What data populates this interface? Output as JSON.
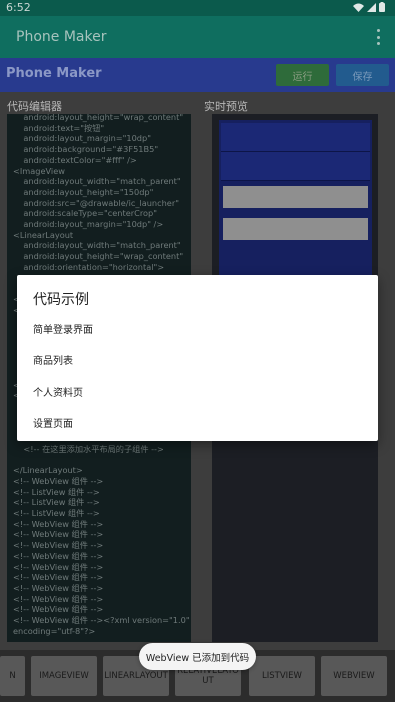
{
  "status": {
    "time": "6:52"
  },
  "appbar": {
    "title": "Phone Maker"
  },
  "toolbar": {
    "title": "Phone Maker",
    "run_label": "运行",
    "save_label": "保存"
  },
  "code_editor": {
    "label": "代码编辑器",
    "text": "    android:layout_height=\"wrap_content\"\n    android:text=\"按钮\"\n    android:layout_margin=\"10dp\"\n    android:background=\"#3F51B5\"\n    android:textColor=\"#fff\" />\n<ImageView\n    android:layout_width=\"match_parent\"\n    android:layout_height=\"150dp\"\n    android:src=\"@drawable/ic_launcher\"\n    android:scaleType=\"centerCrop\"\n    android:layout_margin=\"10dp\" />\n<LinearLayout\n    android:layout_width=\"match_parent\"\n    android:layout_height=\"wrap_content\"\n    android:orientation=\"horizontal\">\n\n\n<\n<\n\n\n\n\n\n\n<\n<\n\n\n\n\n    <!-- 在这里添加水平布局的子组件 -->\n\n</LinearLayout>\n<!-- WebView 组件 -->\n<!-- ListView 组件 -->\n<!-- ListView 组件 -->\n<!-- ListView 组件 -->\n<!-- WebView 组件 -->\n<!-- WebView 组件 -->\n<!-- WebView 组件 -->\n<!-- WebView 组件 -->\n<!-- WebView 组件 -->\n<!-- WebView 组件 -->\n<!-- WebView 组件 -->\n<!-- WebView 组件 -->\n<!-- WebView 组件 -->\n<!-- WebView 组件 --><?xml version=\"1.0\"\nencoding=\"utf-8\"?>"
  },
  "preview": {
    "label": "实时预览"
  },
  "bottom_buttons": [
    "N",
    "IMAGEVIEW",
    "LINEARLAYOUT",
    "RELATIVELAYOUT",
    "LISTVIEW",
    "WEBVIEW"
  ],
  "dialog": {
    "title": "代码示例",
    "items": [
      "简单登录界面",
      "商品列表",
      "个人资料页",
      "设置页面"
    ]
  },
  "toast": "WebView 已添加到代码",
  "icons": {
    "status": [
      "wifi-icon",
      "signal-icon",
      "battery-icon"
    ],
    "appbar": "more-vert-icon"
  },
  "colors": {
    "appbar": "#0f6e5f",
    "toolbar": "#283a8e",
    "run": "#2e6b3a",
    "save": "#225b8e"
  }
}
